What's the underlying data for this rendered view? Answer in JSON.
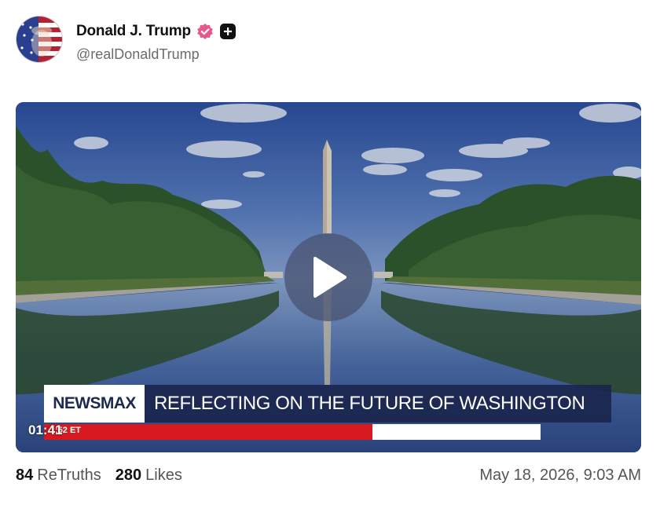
{
  "author": {
    "display_name": "Donald J. Trump",
    "handle": "@realDonaldTrump",
    "avatar_icon": "flag-portrait-avatar",
    "verified_icon": "verified-badge-icon",
    "verified_color": "#e5588e",
    "plus_icon": "plus-badge-icon"
  },
  "video": {
    "duration": "01:41",
    "play_icon": "play-icon",
    "lower_third": {
      "brand": "NEWSMAX",
      "headline": "REFLECTING ON THE FUTURE OF WASHINGTON",
      "ticker_time": ":52 ET",
      "brand_color": "#d71920"
    }
  },
  "stats": {
    "retruths_count": "84",
    "retruths_label": "ReTruths",
    "likes_count": "280",
    "likes_label": "Likes",
    "timestamp": "May 18, 2026, 9:03 AM"
  }
}
